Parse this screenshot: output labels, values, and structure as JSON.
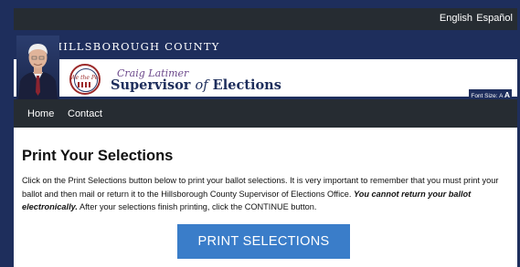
{
  "language": {
    "english": "English",
    "spanish": "Español"
  },
  "header": {
    "county": "HILLSBOROUGH COUNTY",
    "office_line1": "Craig Latimer",
    "office_line2_a": "Supervisor",
    "office_line2_of": "of",
    "office_line2_b": "Elections",
    "seal_text": "We the People",
    "font_size_label": "Font Size:",
    "font_small": "A",
    "font_large": "A"
  },
  "nav": {
    "home": "Home",
    "contact": "Contact"
  },
  "main": {
    "title": "Print Your Selections",
    "instructions_1": "Click on the Print Selections button below to print your ballot selections. It is very important to remember that you must print your ballot and then mail or return it to the Hillsborough County Supervisor of Elections Office. ",
    "instructions_bold": "You cannot return your ballot electronically.",
    "instructions_2": " After your selections finish printing, click the CONTINUE button.",
    "print_button": "PRINT SELECTIONS"
  },
  "colors": {
    "navy": "#1e2e5c",
    "dark_bar": "#262c32",
    "button_blue": "#3a7dc9",
    "office_purple": "#6d4a8c"
  }
}
